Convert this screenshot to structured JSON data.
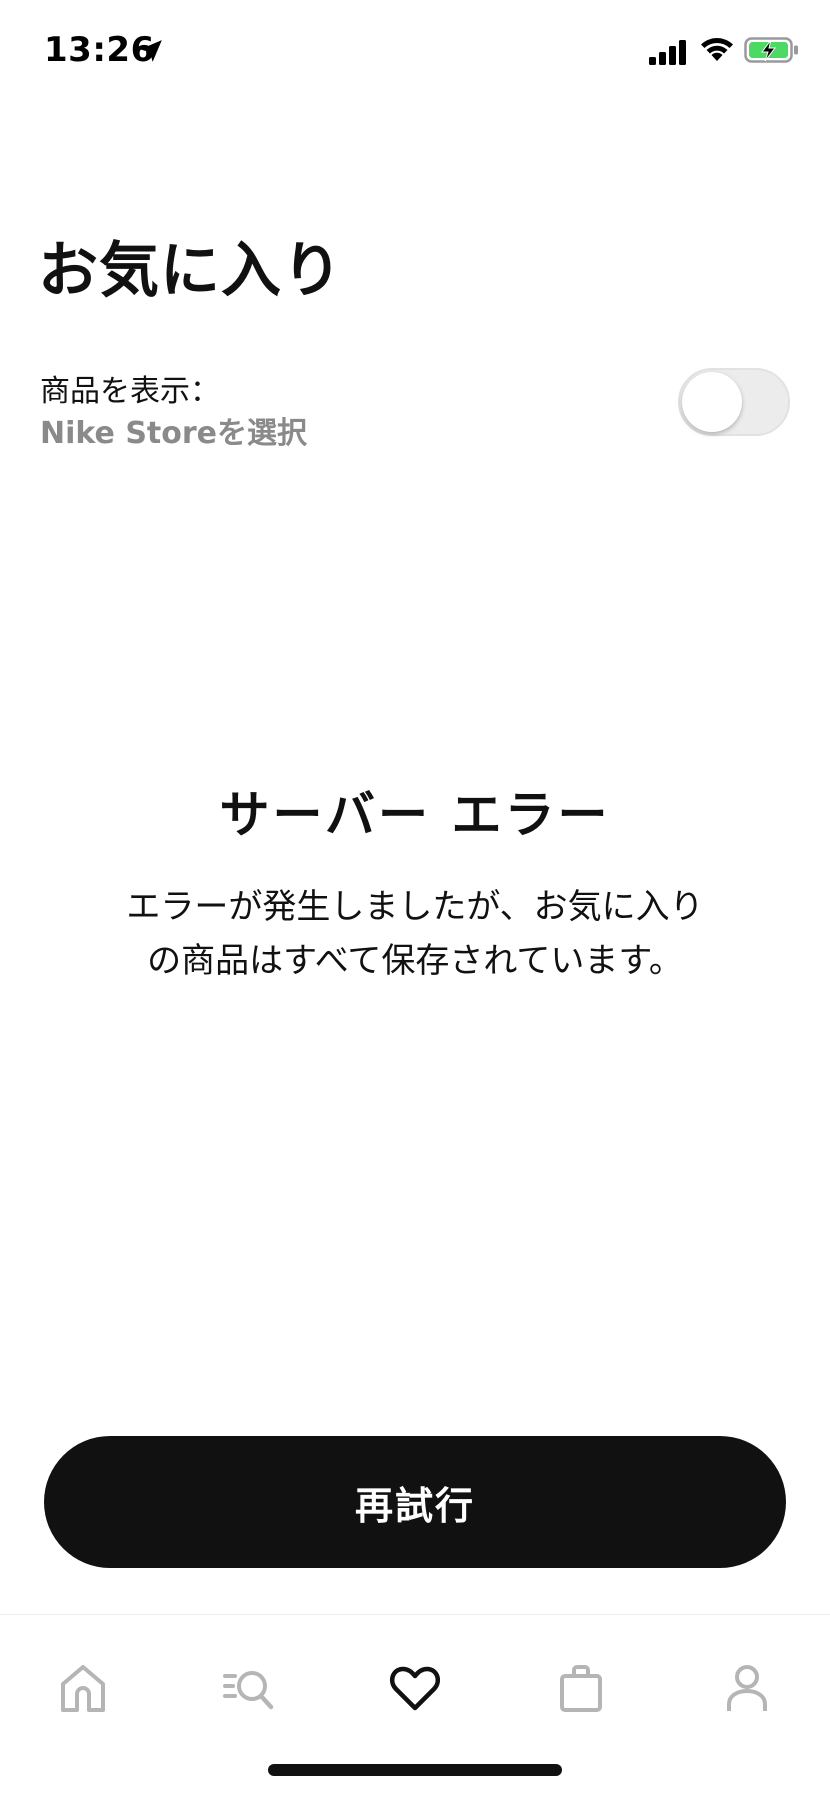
{
  "status_bar": {
    "time": "13:26",
    "icons": [
      "location-arrow-icon",
      "cellular-signal-icon",
      "wifi-icon",
      "battery-charging-icon"
    ],
    "battery_color": "#4cd964"
  },
  "header": {
    "title": "お気に入り"
  },
  "filter": {
    "label": "商品を表示：",
    "store_link": "Nike Storeを選択",
    "toggle_on": false
  },
  "error": {
    "title": "サーバー エラー",
    "message": "エラーが発生しましたが、お気に入りの商品はすべて保存されています。"
  },
  "actions": {
    "retry_label": "再試行"
  },
  "tab_bar": {
    "active": "favorites",
    "tabs": [
      {
        "id": "home",
        "icon": "home-icon"
      },
      {
        "id": "shop",
        "icon": "search-list-icon"
      },
      {
        "id": "favorites",
        "icon": "heart-icon"
      },
      {
        "id": "bag",
        "icon": "bag-icon"
      },
      {
        "id": "profile",
        "icon": "profile-icon"
      }
    ]
  },
  "colors": {
    "text_primary": "#111111",
    "text_secondary": "#8a8a8a",
    "inactive_icon": "#b5b5b5",
    "button_bg": "#111111",
    "button_text": "#ffffff"
  }
}
